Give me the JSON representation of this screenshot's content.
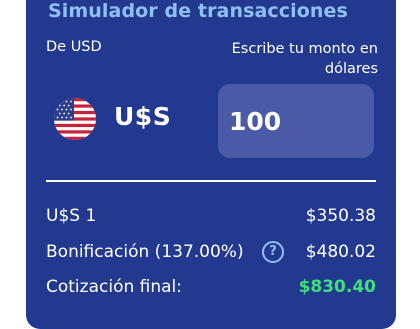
{
  "simulator": {
    "title": "Simulador de transacciones",
    "from_label": "De USD",
    "amount_label": "Escribe tu monto en dólares",
    "currency_icon": "us-flag-icon",
    "currency_code": "U$S",
    "amount_value": "100"
  },
  "results": {
    "rate_label": "U$S 1",
    "rate_value": "$350.38",
    "bonus_label": "Bonificación (137.00%)",
    "bonus_value": "$480.02",
    "final_label": "Cotización final:",
    "final_value": "$830.40"
  },
  "colors": {
    "card_background": "#22398f",
    "title_color": "#8fc0f2",
    "input_background": "#4b5aa6",
    "final_value_color": "#3ee07a"
  }
}
